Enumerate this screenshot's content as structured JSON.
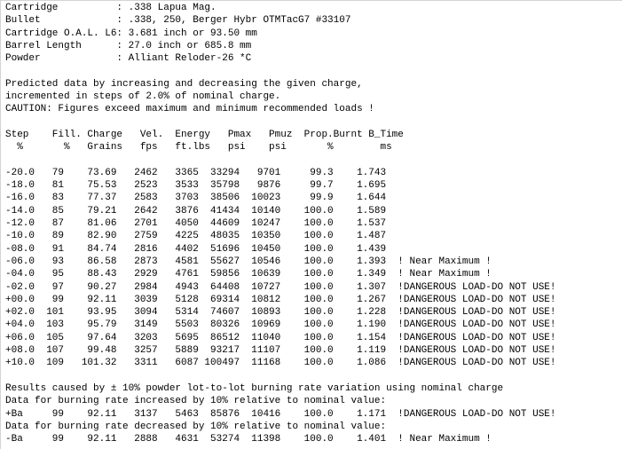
{
  "header": {
    "cartridge": "Cartridge          : .338 Lapua Mag.",
    "bullet": "Bullet             : .338, 250, Berger Hybr OTMTacG7 #33107",
    "oal": "Cartridge O.A.L. L6: 3.681 inch or 93.50 mm",
    "barrel": "Barrel Length      : 27.0 inch or 685.8 mm",
    "powder": "Powder             : Alliant Reloder-26 *C"
  },
  "intro": {
    "line1": "Predicted data by increasing and decreasing the given charge,",
    "line2": "incremented in steps of 2.0% of nominal charge.",
    "caution": "CAUTION: Figures exceed maximum and minimum recommended loads !"
  },
  "table": {
    "header1": "Step    Fill. Charge   Vel.  Energy   Pmax   Pmuz  Prop.Burnt B_Time",
    "header2": "  %       %   Grains   fps   ft.lbs   psi    psi       %        ms",
    "rows": [
      "-20.0   79    73.69   2462   3365  33294   9701     99.3    1.743",
      "-18.0   81    75.53   2523   3533  35798   9876     99.7    1.695",
      "-16.0   83    77.37   2583   3703  38506  10023     99.9    1.644",
      "-14.0   85    79.21   2642   3876  41434  10140    100.0    1.589",
      "-12.0   87    81.06   2701   4050  44609  10247    100.0    1.537",
      "-10.0   89    82.90   2759   4225  48035  10350    100.0    1.487",
      "-08.0   91    84.74   2816   4402  51696  10450    100.0    1.439",
      "-06.0   93    86.58   2873   4581  55627  10546    100.0    1.393  ! Near Maximum !",
      "-04.0   95    88.43   2929   4761  59856  10639    100.0    1.349  ! Near Maximum !",
      "-02.0   97    90.27   2984   4943  64408  10727    100.0    1.307  !DANGEROUS LOAD-DO NOT USE!",
      "+00.0   99    92.11   3039   5128  69314  10812    100.0    1.267  !DANGEROUS LOAD-DO NOT USE!",
      "+02.0  101    93.95   3094   5314  74607  10893    100.0    1.228  !DANGEROUS LOAD-DO NOT USE!",
      "+04.0  103    95.79   3149   5503  80326  10969    100.0    1.190  !DANGEROUS LOAD-DO NOT USE!",
      "+06.0  105    97.64   3203   5695  86512  11040    100.0    1.154  !DANGEROUS LOAD-DO NOT USE!",
      "+08.0  107    99.48   3257   5889  93217  11107    100.0    1.119  !DANGEROUS LOAD-DO NOT USE!",
      "+10.0  109   101.32   3311   6087 100497  11168    100.0    1.086  !DANGEROUS LOAD-DO NOT USE!"
    ]
  },
  "variation": {
    "line1": "Results caused by ± 10% powder lot-to-lot burning rate variation using nominal charge",
    "line2": "Data for burning rate increased by 10% relative to nominal value:",
    "row_plus": "+Ba     99    92.11   3137   5463  85876  10416    100.0    1.171  !DANGEROUS LOAD-DO NOT USE!",
    "line3": "Data for burning rate decreased by 10% relative to nominal value:",
    "row_minus": "-Ba     99    92.11   2888   4631  53274  11398    100.0    1.401  ! Near Maximum !"
  }
}
